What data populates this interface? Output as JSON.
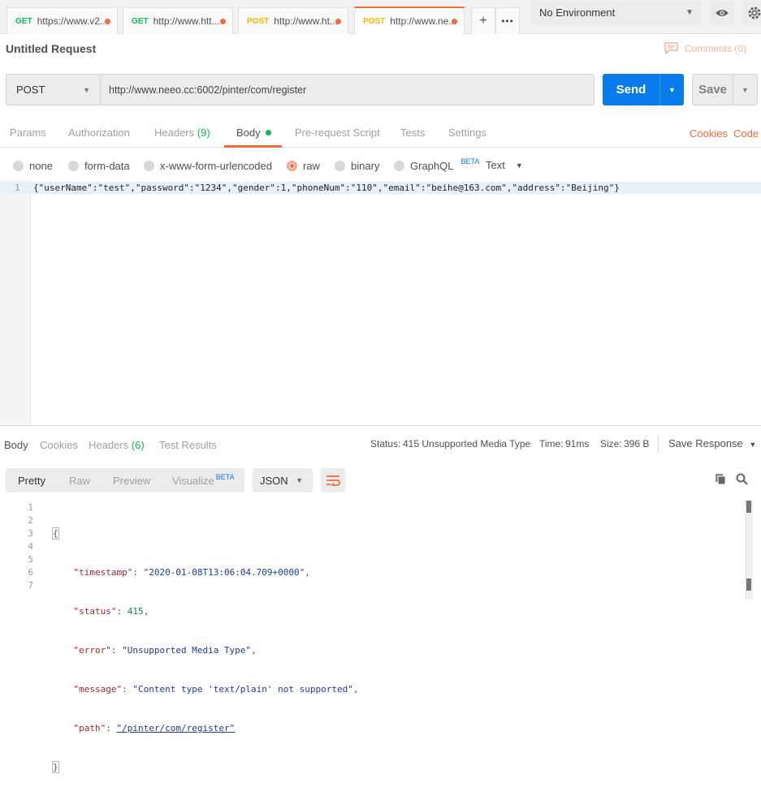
{
  "tabs": [
    {
      "method": "GET",
      "url": "https://www.v2...",
      "color": "#0cbb52"
    },
    {
      "method": "GET",
      "url": "http://www.htt...",
      "color": "#0cbb52"
    },
    {
      "method": "POST",
      "url": "http://www.ht...",
      "color": "#ffb400"
    },
    {
      "method": "POST",
      "url": "http://www.ne...",
      "color": "#ffb400"
    }
  ],
  "environment": "No Environment",
  "request_title": "Untitled Request",
  "comments_label": "Comments (0)",
  "request": {
    "method": "POST",
    "url": "http://www.neeo.cc:6002/pinter/com/register",
    "send_label": "Send",
    "save_label": "Save"
  },
  "request_tabs": {
    "params": "Params",
    "authorization": "Authorization",
    "headers": "Headers",
    "headers_count": "(9)",
    "body": "Body",
    "prerequest": "Pre-request Script",
    "tests": "Tests",
    "settings": "Settings",
    "cookies": "Cookies",
    "code": "Code"
  },
  "body_types": {
    "none": "none",
    "form_data": "form-data",
    "urlencoded": "x-www-form-urlencoded",
    "raw": "raw",
    "binary": "binary",
    "graphql": "GraphQL",
    "beta": "BETA",
    "format": "Text"
  },
  "request_body": {
    "line_no": "1",
    "text": "{\"userName\":\"test\",\"password\":\"1234\",\"gender\":1,\"phoneNum\":\"110\",\"email\":\"beihe@163.com\",\"address\":\"Beijing\"}"
  },
  "response_tabs": {
    "body": "Body",
    "cookies": "Cookies",
    "headers": "Headers",
    "headers_count": "(6)",
    "test_results": "Test Results"
  },
  "response_status": {
    "status_label": "Status:",
    "status_value": "415 Unsupported Media Type",
    "time_label": "Time:",
    "time_value": "91ms",
    "size_label": "Size:",
    "size_value": "396 B",
    "save_response": "Save Response"
  },
  "response_view": {
    "pretty": "Pretty",
    "raw": "Raw",
    "preview": "Preview",
    "visualize": "Visualize",
    "beta": "BETA",
    "format": "JSON"
  },
  "response_body": {
    "line_numbers": [
      "1",
      "2",
      "3",
      "4",
      "5",
      "6",
      "7"
    ],
    "open_brace": "{",
    "close_brace": "}",
    "fields": [
      {
        "key": "\"timestamp\"",
        "value": "\"2020-01-08T13:06:04.709+0000\"",
        "comma": ","
      },
      {
        "key": "\"status\"",
        "value": "415",
        "comma": ","
      },
      {
        "key": "\"error\"",
        "value": "\"Unsupported Media Type\"",
        "comma": ","
      },
      {
        "key": "\"message\"",
        "value": "\"Content type 'text/plain' not supported\"",
        "comma": ","
      },
      {
        "key": "\"path\"",
        "value": "\"/pinter/com/register\"",
        "comma": ""
      }
    ]
  }
}
